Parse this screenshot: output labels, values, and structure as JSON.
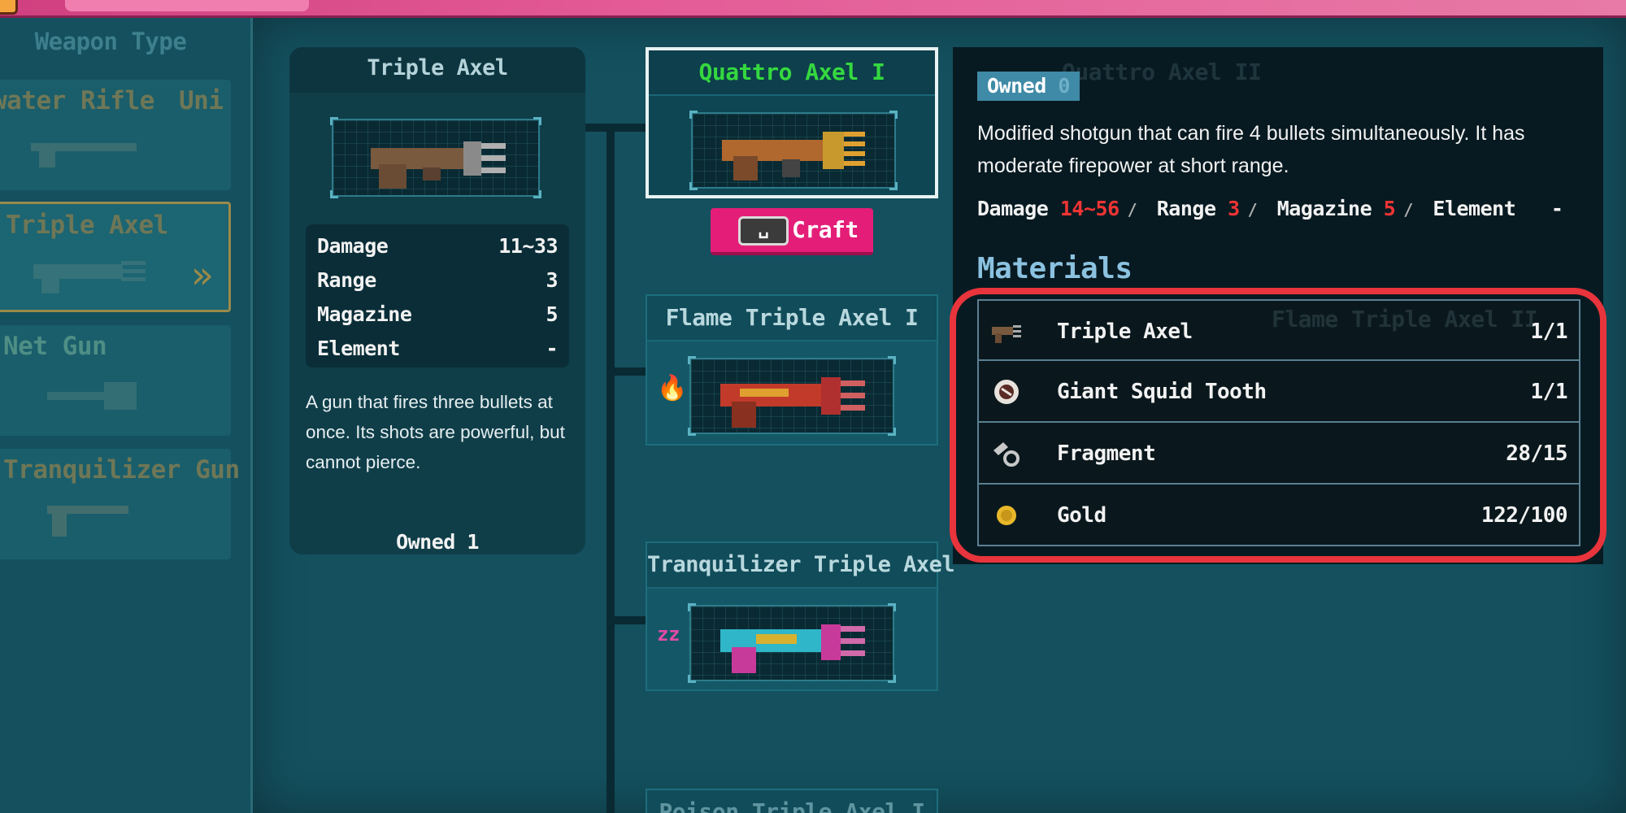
{
  "sidebar": {
    "title": "Weapon Type",
    "items": [
      {
        "label": "water Rifle",
        "extra": "Uni"
      },
      {
        "label": "Triple Axel"
      },
      {
        "label": "Net Gun"
      },
      {
        "label": "Tranquilizer Gun"
      }
    ]
  },
  "base_weapon": {
    "name": "Triple Axel",
    "stats": [
      {
        "label": "Damage",
        "value": "11~33"
      },
      {
        "label": "Range",
        "value": "3"
      },
      {
        "label": "Magazine",
        "value": "5"
      },
      {
        "label": "Element",
        "value": "-"
      }
    ],
    "description": "A gun that fires three bullets at once. Its shots are powerful, but cannot pierce.",
    "owned": "Owned 1"
  },
  "upgrades": [
    {
      "name": "Quattro Axel I",
      "selected": true
    },
    {
      "name": "Flame Triple Axel  I",
      "element_icon": "flame-icon"
    },
    {
      "name": "Tranquilizer Triple Axel",
      "element_icon": "sleep-icon"
    },
    {
      "name": "Poison Triple Axel I"
    }
  ],
  "craft": {
    "key": "␣",
    "label": "Craft"
  },
  "detail": {
    "owned_label": "Owned",
    "owned_count": "0",
    "description": "Modified shotgun that can fire 4 bullets simultaneously. It has moderate firepower at short range.",
    "stats": {
      "damage_label": "Damage",
      "damage": "14~56",
      "range_label": "Range",
      "range": "3",
      "magazine_label": "Magazine",
      "magazine": "5",
      "element_label": "Element",
      "element": "-"
    },
    "materials_title": "Materials",
    "materials": [
      {
        "icon": "triple-axel-icon",
        "name": "Triple Axel",
        "count": "1/1"
      },
      {
        "icon": "squid-tooth-icon",
        "name": "Giant Squid Tooth",
        "count": "1/1"
      },
      {
        "icon": "fragment-icon",
        "name": "Fragment",
        "count": "28/15"
      },
      {
        "icon": "gold-coin-icon",
        "name": "Gold",
        "count": "122/100"
      }
    ]
  },
  "ghost_labels": {
    "a": "Quattro Axel II",
    "b": "Flame Triple Axel II"
  },
  "colors": {
    "accent_pink": "#e41e78",
    "selected_green": "#35d83f",
    "highlight_red": "#e8343c",
    "stat_red": "#f03434"
  }
}
